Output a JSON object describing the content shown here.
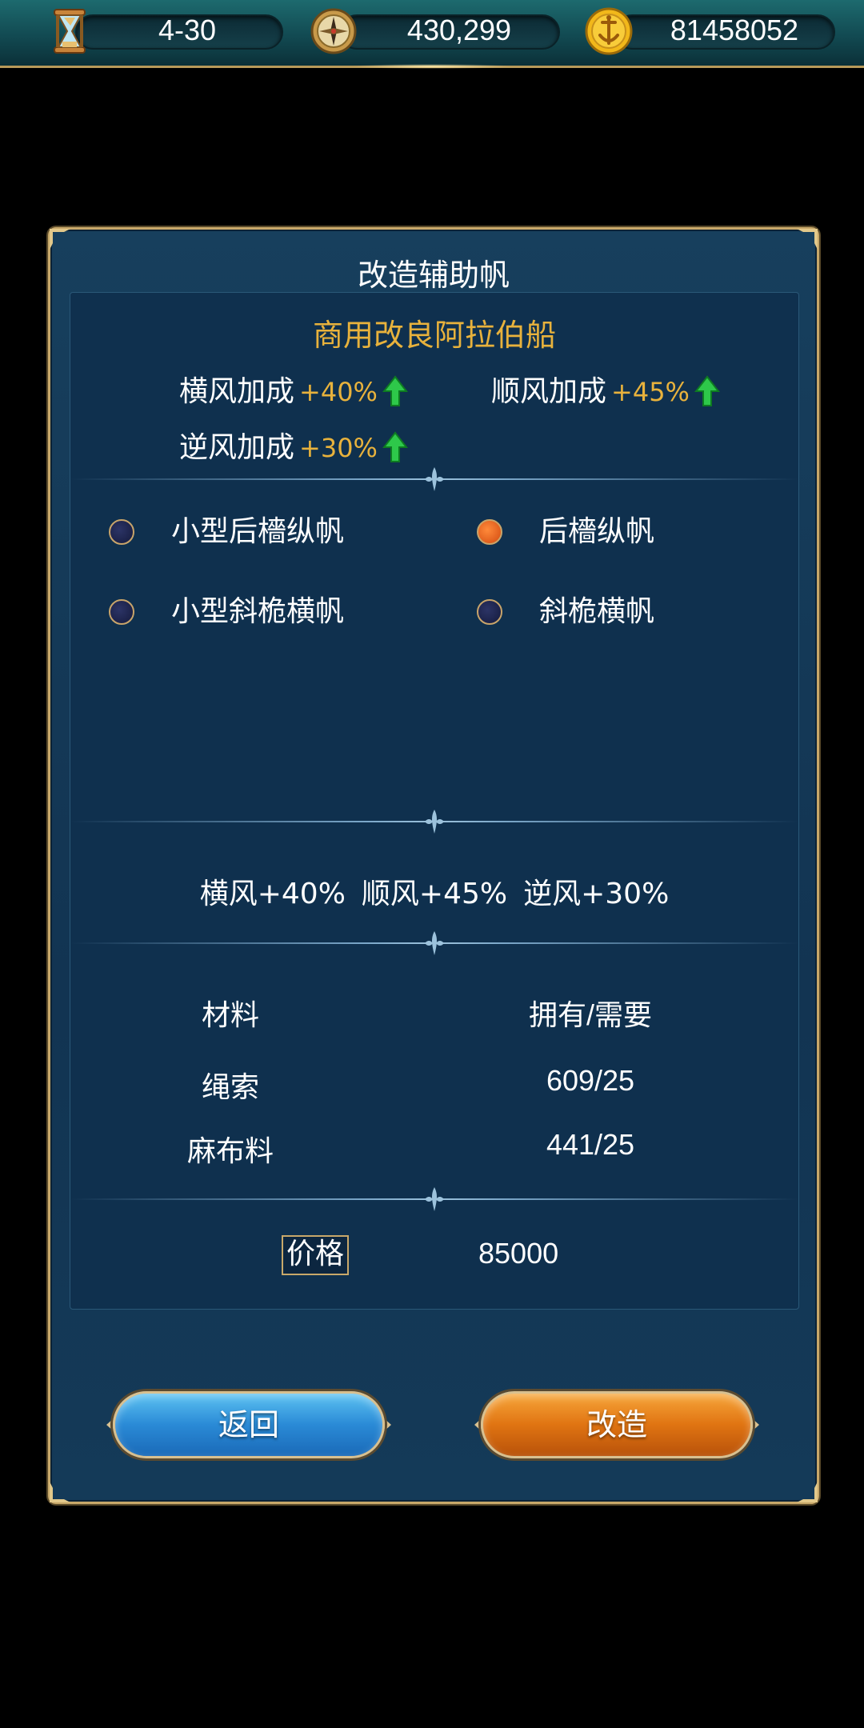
{
  "topbar": {
    "date": "4-30",
    "fame": "430,299",
    "gold": "81458052"
  },
  "dialog": {
    "title": "改造辅助帆",
    "ship_name": "商用改良阿拉伯船",
    "bonuses": [
      {
        "label": "横风加成",
        "value": "+40%"
      },
      {
        "label": "顺风加成",
        "value": "+45%"
      },
      {
        "label": "逆风加成",
        "value": "+30%"
      }
    ],
    "options": [
      {
        "label": "小型后檣纵帆",
        "selected": false
      },
      {
        "label": "后檣纵帆",
        "selected": true
      },
      {
        "label": "小型斜桅横帆",
        "selected": false
      },
      {
        "label": "斜桅横帆",
        "selected": false
      }
    ],
    "summary": [
      "横风+40%",
      "顺风+45%",
      "逆风+30%"
    ],
    "materials": {
      "header_name": "材料",
      "header_qty": "拥有/需要",
      "rows": [
        {
          "name": "绳索",
          "qty": "609/25"
        },
        {
          "name": "麻布料",
          "qty": "441/25"
        }
      ]
    },
    "price_label": "价格",
    "price_value": "85000",
    "back_label": "返回",
    "confirm_label": "改造"
  },
  "colors": {
    "accent_gold": "#e8b23c",
    "panel": "#0f304e",
    "button_blue": "#2a8ad6",
    "button_orange": "#e07412",
    "radio_selected": "#d24a10"
  }
}
